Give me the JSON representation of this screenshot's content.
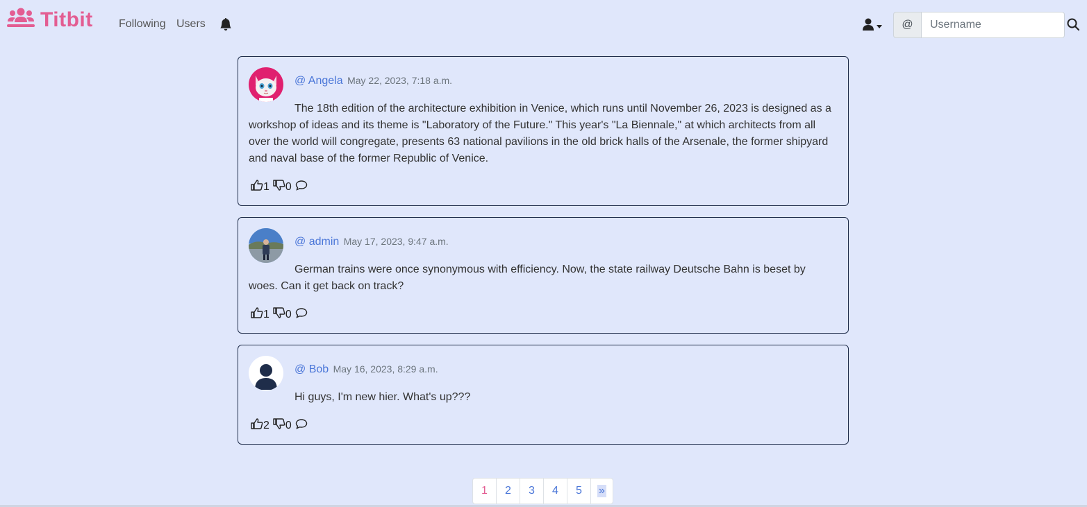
{
  "brand": {
    "name": "Titbit",
    "color": "#e35d92"
  },
  "nav": {
    "following": "Following",
    "users": "Users"
  },
  "search": {
    "prefix": "@",
    "placeholder": "Username"
  },
  "posts": [
    {
      "username": "@ Angela",
      "timestamp": "May 22, 2023, 7:18 a.m.",
      "body": "The 18th edition of the architecture exhibition in Venice, which runs until November 26, 2023 is designed as a workshop of ideas and its theme is \"Laboratory of the Future.\" This year's \"La Biennale,\" at which architects from all over the world will congregate, presents 63 national pavilions in the old brick halls of the Arsenale, the former shipyard and naval base of the former Republic of Venice.",
      "likes": "1",
      "dislikes": "0",
      "avatar": "cartoon-cat-avatar"
    },
    {
      "username": "@ admin",
      "timestamp": "May 17, 2023, 9:47 a.m.",
      "body": "German trains were once synonymous with efficiency. Now, the state railway Deutsche Bahn is beset by woes. Can it get back on track?",
      "likes": "1",
      "dislikes": "0",
      "avatar": "photo-avatar"
    },
    {
      "username": "@ Bob",
      "timestamp": "May 16, 2023, 8:29 a.m.",
      "body": "Hi guys, I'm new hier. What's up???",
      "likes": "2",
      "dislikes": "0",
      "avatar": "default-user-avatar"
    }
  ],
  "pagination": {
    "pages": [
      "1",
      "2",
      "3",
      "4",
      "5"
    ],
    "next": "»",
    "active": "1"
  },
  "colors": {
    "background": "#e0e7fb",
    "link": "#4a76d8",
    "accent": "#e35d92",
    "border": "#1f2d4a"
  }
}
